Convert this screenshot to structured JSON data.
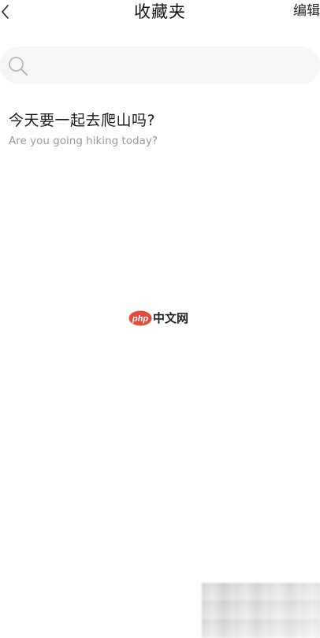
{
  "header": {
    "title": "收藏夹",
    "edit_label": "编辑",
    "back_icon": "chevron-left-icon"
  },
  "search": {
    "icon": "search-icon",
    "placeholder": ""
  },
  "favorites": [
    {
      "title": "今天要一起去爬山吗?",
      "subtitle": "Are you going hiking today?"
    }
  ],
  "watermark": {
    "logo_text": "php",
    "text": "中文网"
  },
  "colors": {
    "search_bg": "#f5f6f8",
    "subtitle": "#9a9a9a",
    "watermark_logo": "#e64a3a"
  }
}
